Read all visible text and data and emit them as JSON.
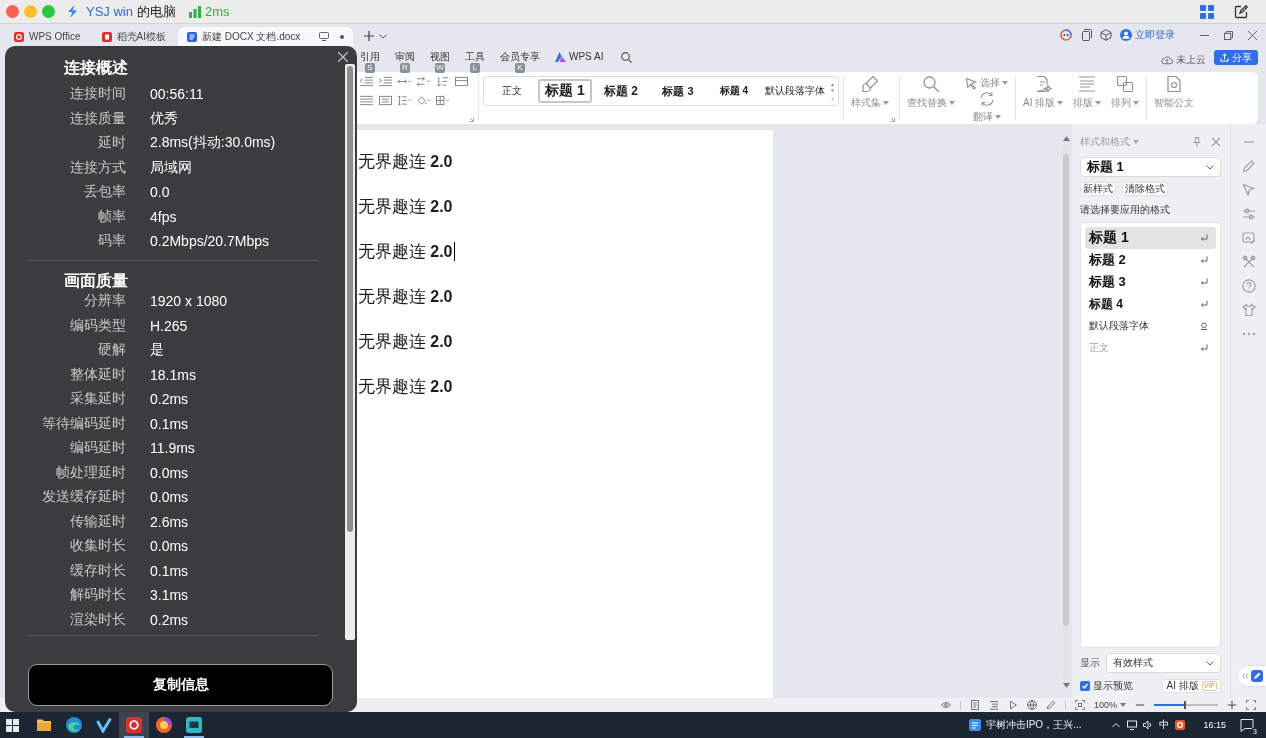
{
  "mac_bar": {
    "host": "YSJ win",
    "host_suffix": "的电脑",
    "latency": "2ms"
  },
  "overlay": {
    "sections": [
      {
        "title": "连接概述",
        "rows": [
          {
            "label": "连接时间",
            "value": "00:56:11"
          },
          {
            "label": "连接质量",
            "value": "优秀"
          },
          {
            "label": "延时",
            "value": "2.8ms(抖动:30.0ms)"
          },
          {
            "label": "连接方式",
            "value": "局域网"
          },
          {
            "label": "丢包率",
            "value": "0.0"
          },
          {
            "label": "帧率",
            "value": "4fps"
          },
          {
            "label": "码率",
            "value": "0.2Mbps/20.7Mbps"
          }
        ]
      },
      {
        "title": "画面质量",
        "rows": [
          {
            "label": "分辨率",
            "value": "1920 x 1080"
          },
          {
            "label": "编码类型",
            "value": "H.265"
          },
          {
            "label": "硬解",
            "value": "是"
          },
          {
            "label": "整体延时",
            "value": "18.1ms"
          },
          {
            "label": "采集延时",
            "value": "0.2ms"
          },
          {
            "label": "等待编码延时",
            "value": "0.1ms"
          },
          {
            "label": "编码延时",
            "value": "11.9ms"
          },
          {
            "label": "帧处理延时",
            "value": "0.0ms"
          },
          {
            "label": "发送缓存延时",
            "value": "0.0ms"
          },
          {
            "label": "传输延时",
            "value": "2.6ms"
          },
          {
            "label": "收集时长",
            "value": "0.0ms"
          },
          {
            "label": "缓存时长",
            "value": "0.1ms"
          },
          {
            "label": "解码时长",
            "value": "3.1ms"
          },
          {
            "label": "渲染时长",
            "value": "0.2ms"
          }
        ]
      }
    ],
    "copy_button": "复制信息"
  },
  "app_tabs": [
    {
      "label": "WPS Office",
      "kind": "home",
      "selected": false
    },
    {
      "label": "稻壳AI模板",
      "kind": "template",
      "selected": false
    },
    {
      "label": "新建 DOCX 文档.docx",
      "kind": "document",
      "selected": true
    }
  ],
  "account": {
    "login": "立即登录"
  },
  "menu": [
    {
      "label": "引用",
      "kind": "tab",
      "key": "S"
    },
    {
      "label": "审阅",
      "kind": "tab",
      "key": "R"
    },
    {
      "label": "视图",
      "kind": "tab",
      "key": "W"
    },
    {
      "label": "工具",
      "kind": "tab",
      "key": "L"
    },
    {
      "label": "会员专享",
      "kind": "tab",
      "key": "K"
    },
    {
      "label": "WPS AI",
      "kind": "ai"
    }
  ],
  "cloud_status": "未上云",
  "share_button": "分享",
  "style_gallery": [
    {
      "label": "正文",
      "kind": "body",
      "selected": false
    },
    {
      "label": "标题 1",
      "kind": "h1",
      "selected": true
    },
    {
      "label": "标题 2",
      "kind": "h2",
      "selected": false
    },
    {
      "label": "标题 3",
      "kind": "h3",
      "selected": false
    },
    {
      "label": "标题 4",
      "kind": "h4",
      "selected": false
    },
    {
      "label": "默认段落字体",
      "kind": "char",
      "selected": false
    }
  ],
  "ribbon_groups": [
    {
      "tools": [
        {
          "label": "样式集",
          "kind": "styles",
          "dropdown": true
        }
      ]
    },
    {
      "tools": [
        {
          "label": "查找替换",
          "kind": "find",
          "dropdown": true
        }
      ],
      "stack": [
        {
          "label": "选择",
          "kind": "select",
          "dropdown": true
        },
        {
          "label": "翻译",
          "kind": "translate",
          "dropdown": true
        }
      ]
    },
    {
      "tools": [
        {
          "label": "AI 排版",
          "kind": "ai",
          "dropdown": true
        },
        {
          "label": "排版",
          "kind": "layout",
          "dropdown": true
        },
        {
          "label": "排列",
          "kind": "arrange",
          "dropdown": true
        }
      ]
    },
    {
      "tools": [
        {
          "label": "智能公文",
          "kind": "official",
          "dropdown": false
        }
      ]
    }
  ],
  "document": {
    "paragraphs": [
      {
        "text": "无界趣连 **2.0**",
        "caret": false
      },
      {
        "text": "无界趣连 **2.0**",
        "caret": false
      },
      {
        "text": "无界趣连 **2.0**",
        "caret": true
      },
      {
        "text": "无界趣连 **2.0**",
        "caret": false
      },
      {
        "text": "无界趣连 **2.0**",
        "caret": false
      },
      {
        "text": "无界趣连 **2.0**",
        "caret": false
      }
    ]
  },
  "style_pane": {
    "title": "样式和格式",
    "current": "标题 1",
    "buttons": [
      "新样式",
      "清除格式"
    ],
    "prompt": "请选择要应用的格式",
    "styles": [
      {
        "label": "标题 1",
        "kind": "h1",
        "selected": true
      },
      {
        "label": "标题 2",
        "kind": "h2",
        "selected": false
      },
      {
        "label": "标题 3",
        "kind": "h3",
        "selected": false
      },
      {
        "label": "标题 4",
        "kind": "h4",
        "selected": false
      },
      {
        "label": "默认段落字体",
        "kind": "char",
        "selected": false
      },
      {
        "label": "正文",
        "kind": "body",
        "selected": false
      }
    ],
    "show_label": "显示",
    "show_value": "有效样式",
    "preview": {
      "label": "显示预览",
      "checked": true
    },
    "ai_button": "AI 排版",
    "ai_badge": "VIP"
  },
  "status_bar": {
    "zoom": {
      "label": "100%",
      "level": 0.5
    }
  },
  "taskbar": {
    "apps": [
      {
        "kind": "folder",
        "running": false,
        "selected": false
      },
      {
        "kind": "browser",
        "running": false,
        "selected": false
      },
      {
        "kind": "check",
        "running": false,
        "selected": false
      },
      {
        "kind": "office",
        "running": true,
        "selected": true
      },
      {
        "kind": "orb",
        "running": false,
        "selected": false
      },
      {
        "kind": "remote",
        "running": true,
        "selected": false
      }
    ],
    "news": "宇树冲击IPO，王兴...",
    "ime": "中",
    "time": "16:15",
    "notification_count": "3"
  }
}
